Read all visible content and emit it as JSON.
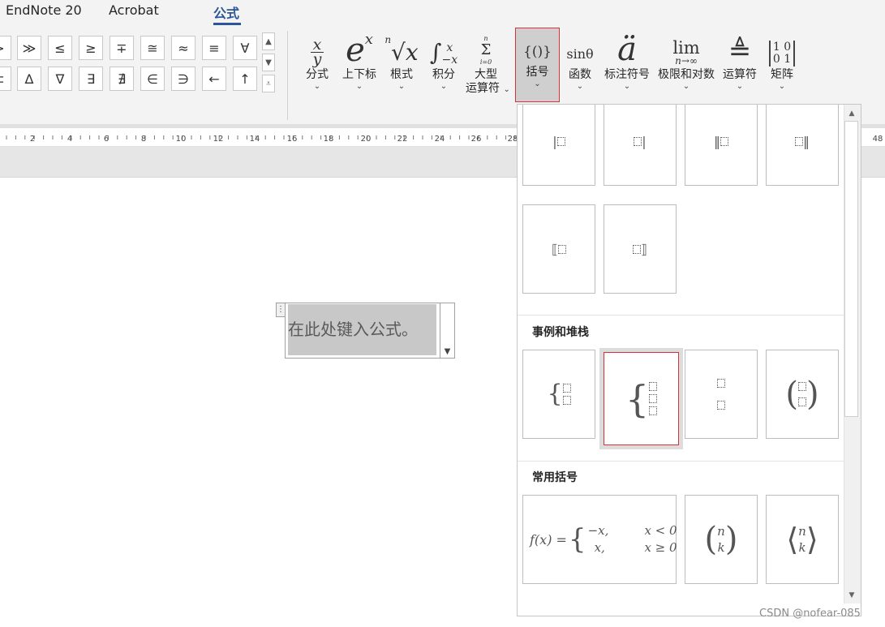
{
  "tabs": [
    {
      "label": "EndNote 20"
    },
    {
      "label": "Acrobat"
    },
    {
      "label": "公式"
    }
  ],
  "symbols": {
    "row1": [
      ">",
      "≫",
      "≤",
      "≥",
      "∓",
      "≅",
      "≈",
      "≡",
      "∀"
    ],
    "row2": [
      "⊂",
      "∆",
      "∇",
      "∃",
      "∄",
      "∈",
      "∋",
      "←",
      "↑"
    ]
  },
  "ribbon_buttons": [
    {
      "name": "fraction",
      "label": "分式"
    },
    {
      "name": "script",
      "label": "上下标"
    },
    {
      "name": "radical",
      "label": "根式"
    },
    {
      "name": "integral",
      "label": "积分"
    },
    {
      "name": "large-operator",
      "label": "大型",
      "label2": "运算符"
    },
    {
      "name": "bracket",
      "label": "括号"
    },
    {
      "name": "function",
      "label": "函数"
    },
    {
      "name": "accent",
      "label": "标注符号"
    },
    {
      "name": "limit-log",
      "label": "极限和对数"
    },
    {
      "name": "operator",
      "label": "运算符"
    },
    {
      "name": "matrix",
      "label": "矩阵"
    }
  ],
  "glyphs": {
    "fraction_num": "x",
    "fraction_den": "y",
    "script_base": "e",
    "script_sup": "x",
    "radical_index": "n",
    "radical_body": "√x",
    "integral": "∫",
    "integral_upper": "x",
    "integral_lower": "−x",
    "sum_top": "n",
    "sum": "Σ",
    "sum_bottom": "i=0",
    "bracket": "{()}",
    "function": "sinθ",
    "accent": "ä",
    "lim": "lim",
    "lim_sub": "n→∞",
    "operator": "≜",
    "matrix_r1": "1 0",
    "matrix_r2": "0 1"
  },
  "ruler": {
    "labels": [
      "2",
      "4",
      "6",
      "8",
      "10",
      "12",
      "14",
      "16",
      "18",
      "20",
      "22",
      "24",
      "26",
      "28",
      "48"
    ]
  },
  "document": {
    "equation_placeholder": "在此处键入公式。"
  },
  "panel": {
    "sections": [
      {
        "title": "事例和堆栈"
      },
      {
        "title": "常用括号"
      }
    ],
    "cells_top": [
      "|□",
      "□|",
      "‖□",
      "□‖",
      "⟦□",
      "□⟧"
    ],
    "piecewise": {
      "lhs": "f(x) =",
      "case1_val": "−x,",
      "case1_cond": "x < 0",
      "case2_val": "x,",
      "case2_cond": "x ≥ 0"
    },
    "binom": {
      "top": "n",
      "bottom": "k"
    }
  },
  "watermark": "CSDN @nofear-085",
  "colors": {
    "accent": "#2b579a",
    "highlight_border": "#d13438",
    "ribbon_bg": "#f3f3f3"
  }
}
